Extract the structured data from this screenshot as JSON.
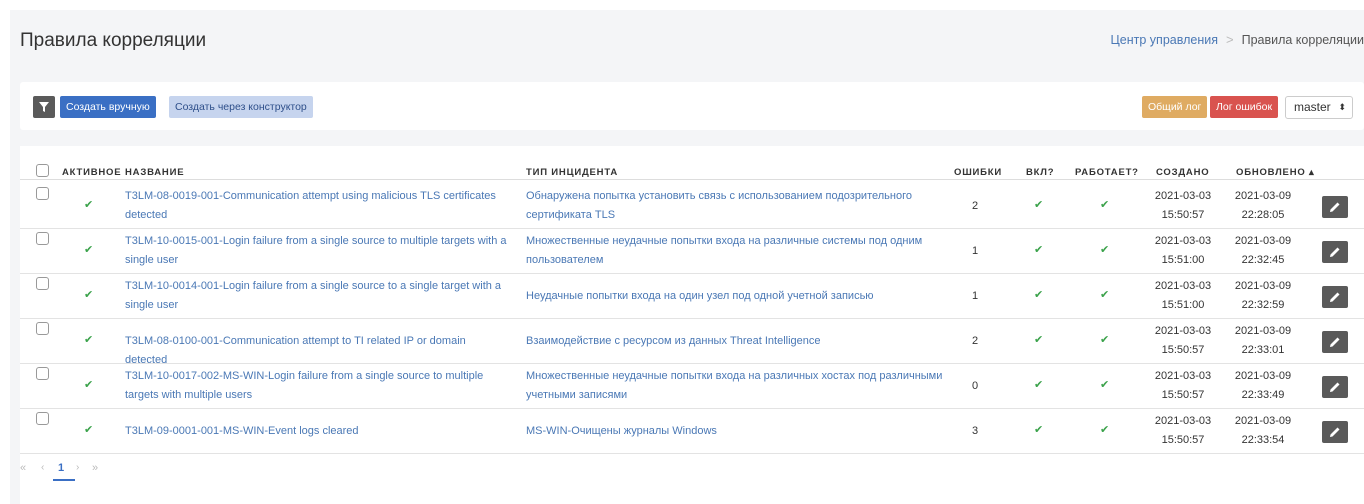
{
  "page": {
    "title": "Правила корреляции",
    "breadcrumb": [
      "Центр управления",
      "Правила корреляции"
    ]
  },
  "toolbar": {
    "filter_icon": "filter-icon",
    "create_manual_label": "Создать вручную",
    "create_constructor_label": "Создать через конструктор",
    "general_log_label": "Общий лог",
    "error_log_label": "Лог ошибок",
    "branch_value": "master"
  },
  "table": {
    "columns": {
      "active": "АКТИВНОЕ",
      "name": "НАЗВАНИЕ",
      "incident_type": "ТИП ИНЦИДЕНТА",
      "errors": "ОШИБКИ",
      "enabled": "ВКЛ?",
      "working": "РАБОТАЕТ?",
      "created": "СОЗДАНО",
      "updated": "ОБНОВЛЕНО ▴"
    },
    "rows": [
      {
        "name_line1": "T3LM-08-0019-001-Communication attempt using malicious TLS certificates",
        "name_line2": "detected",
        "type_line1": "Обнаружена попытка установить связь с использованием подозрительного",
        "type_line2": "сертификата TLS",
        "errors": "2",
        "created_date": "2021-03-03",
        "created_time": "15:50:57",
        "updated_date": "2021-03-09",
        "updated_time": "22:28:05"
      },
      {
        "name_line1": "T3LM-10-0015-001-Login failure from a single source to multiple targets with a",
        "name_line2": "single user",
        "type_line1": "Множественные неудачные попытки входа на различные системы под одним",
        "type_line2": "пользователем",
        "errors": "1",
        "created_date": "2021-03-03",
        "created_time": "15:51:00",
        "updated_date": "2021-03-09",
        "updated_time": "22:32:45"
      },
      {
        "name_line1": "T3LM-10-0014-001-Login failure from a single source to a single target with a",
        "name_line2": "single user",
        "type_line1": "Неудачные попытки входа на один узел под одной учетной записью",
        "type_line2": "",
        "errors": "1",
        "created_date": "2021-03-03",
        "created_time": "15:51:00",
        "updated_date": "2021-03-09",
        "updated_time": "22:32:59"
      },
      {
        "name_line1": "T3LM-08-0100-001-Communication attempt to TI related IP or domain detected",
        "name_line2": "",
        "type_line1": "Взаимодействие с ресурсом из данных Threat Intelligence",
        "type_line2": "",
        "errors": "2",
        "created_date": "2021-03-03",
        "created_time": "15:50:57",
        "updated_date": "2021-03-09",
        "updated_time": "22:33:01"
      },
      {
        "name_line1": "T3LM-10-0017-002-MS-WIN-Login failure from a single source to multiple",
        "name_line2": "targets with multiple users",
        "type_line1": "Множественные неудачные попытки входа на различных хостах под различными",
        "type_line2": "учетными записями",
        "errors": "0",
        "created_date": "2021-03-03",
        "created_time": "15:50:57",
        "updated_date": "2021-03-09",
        "updated_time": "22:33:49"
      },
      {
        "name_line1": "T3LM-09-0001-001-MS-WIN-Event logs cleared",
        "name_line2": "",
        "type_line1": "MS-WIN-Очищены журналы Windows",
        "type_line2": "",
        "errors": "3",
        "created_date": "2021-03-03",
        "created_time": "15:50:57",
        "updated_date": "2021-03-09",
        "updated_time": "22:33:54"
      }
    ]
  },
  "pagination": {
    "first": "«",
    "prev": "‹",
    "current": "1",
    "next": "›",
    "last": "»"
  },
  "colors": {
    "accent": "#3a6fc4",
    "link": "#4a78b5",
    "check": "#3aa24a",
    "general_log": "#dfab62",
    "error_log": "#d9534f"
  }
}
